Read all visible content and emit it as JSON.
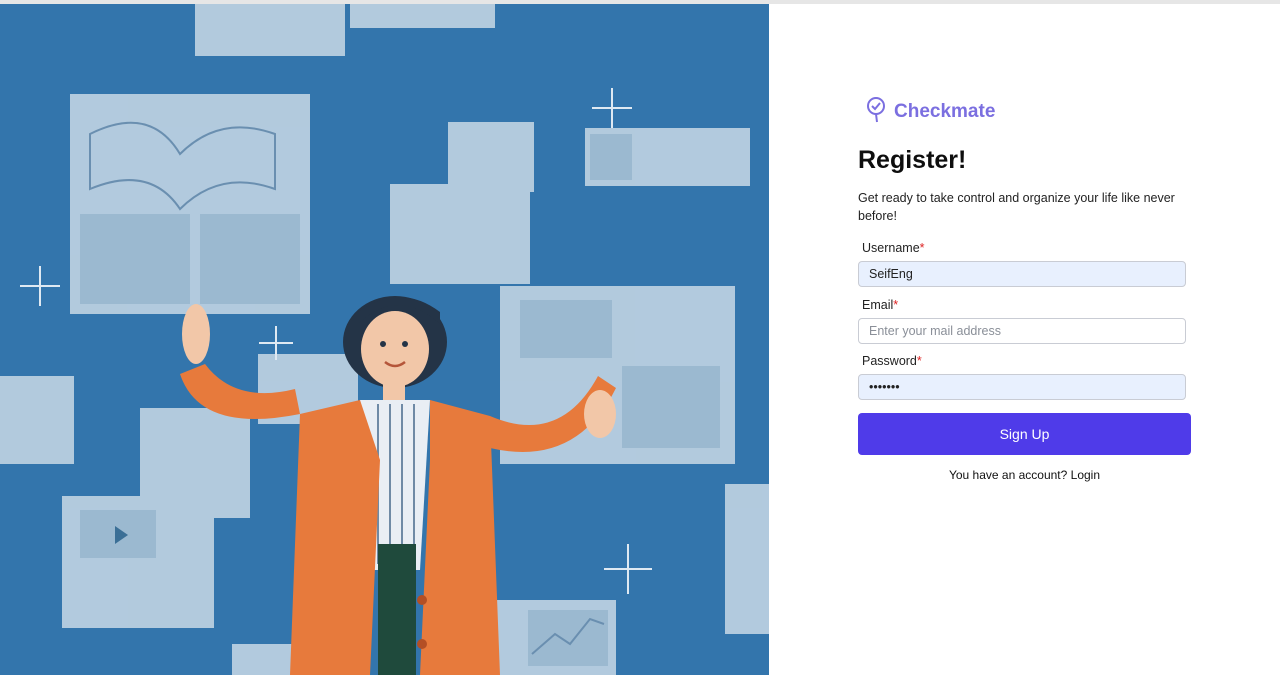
{
  "brand": {
    "name": "Checkmate",
    "logo_icon": "pin-check-icon",
    "color": "#7b6fe0"
  },
  "register": {
    "title": "Register!",
    "subtitle": "Get ready to take control and organize your life like never before!"
  },
  "form": {
    "username": {
      "label": "Username",
      "required_mark": "*",
      "value": "SeifEng"
    },
    "email": {
      "label": "Email",
      "required_mark": "*",
      "value": "",
      "placeholder": "Enter your mail address"
    },
    "password": {
      "label": "Password",
      "required_mark": "*",
      "value": "•••••••"
    },
    "submit_label": "Sign Up",
    "submit_color": "#4f3be9"
  },
  "footer": {
    "prompt": "You have an account?",
    "login_link": "Login"
  },
  "hero": {
    "illustration": "woman-with-floating-documents"
  }
}
